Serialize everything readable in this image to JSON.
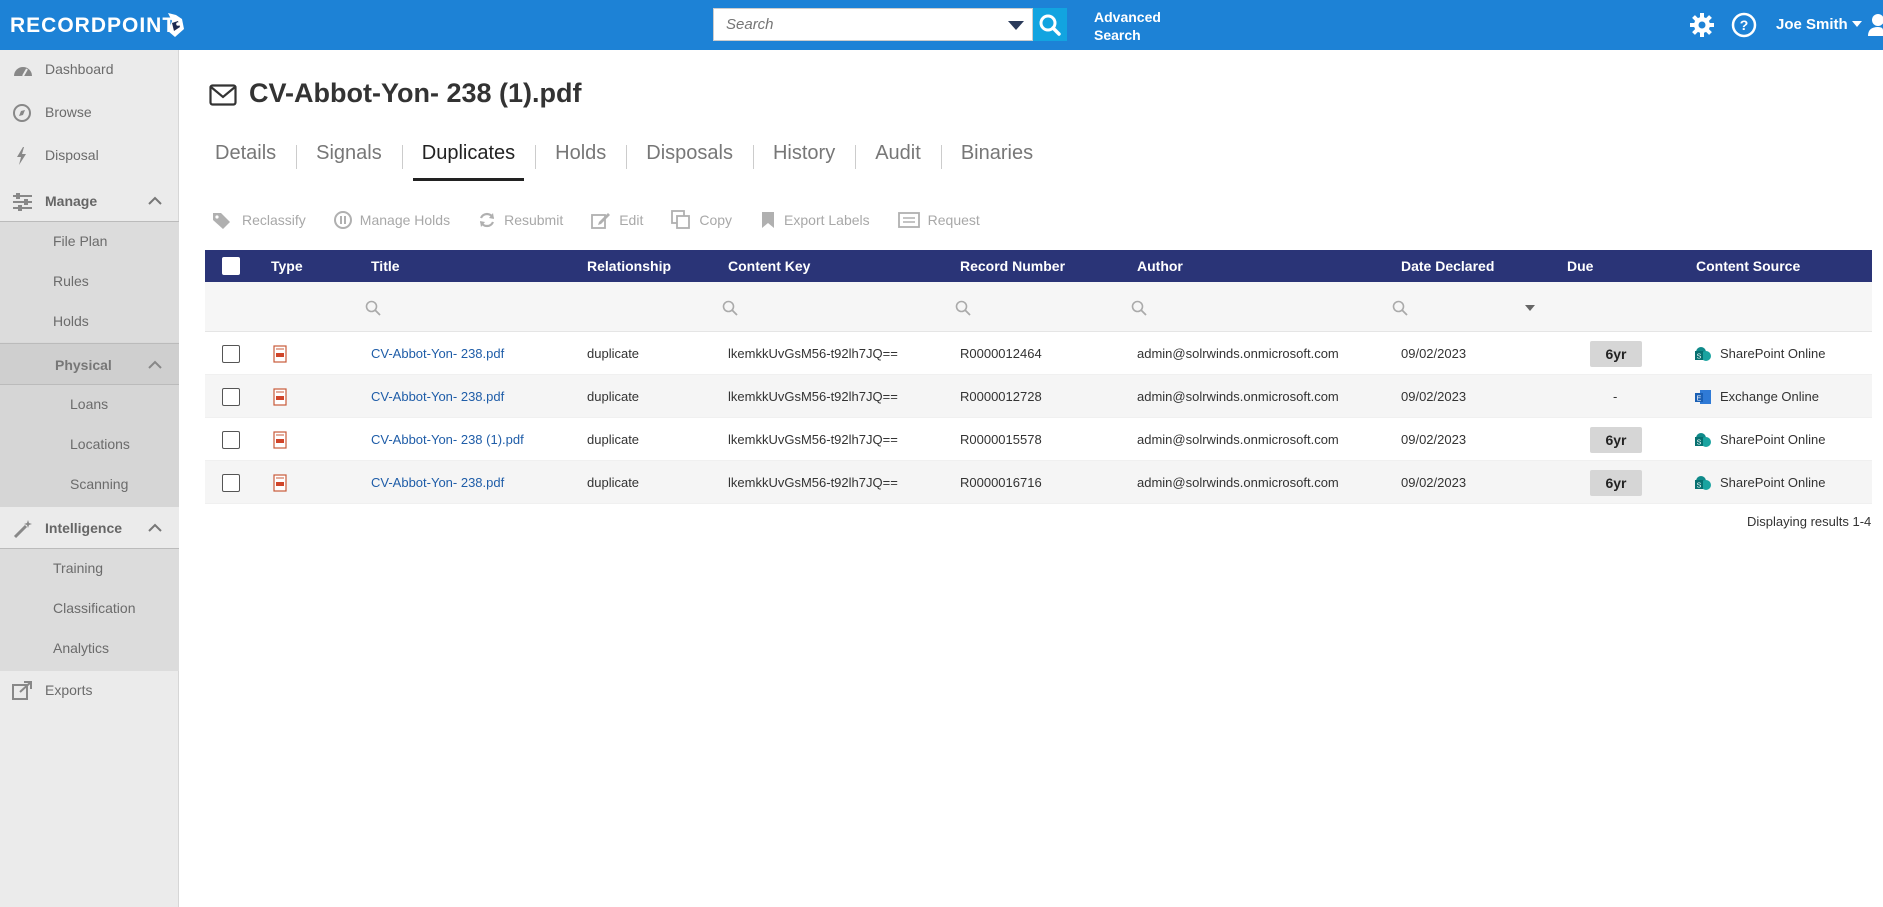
{
  "header": {
    "logo": "RECORDPOINT",
    "search_placeholder": "Search",
    "advanced_search_line1": "Advanced",
    "advanced_search_line2": "Search",
    "user_name": "Joe Smith",
    "colors": {
      "topbar": "#1d82d6",
      "search_button": "#12a4e0"
    }
  },
  "sidebar": {
    "dashboard": "Dashboard",
    "browse": "Browse",
    "disposal": "Disposal",
    "manage": "Manage",
    "manage_items": [
      "File Plan",
      "Rules",
      "Holds"
    ],
    "physical": "Physical",
    "physical_items": [
      "Loans",
      "Locations",
      "Scanning"
    ],
    "intelligence": "Intelligence",
    "intelligence_items": [
      "Training",
      "Classification",
      "Analytics"
    ],
    "exports": "Exports"
  },
  "page": {
    "title": "CV-Abbot-Yon- 238 (1).pdf",
    "tabs": [
      "Details",
      "Signals",
      "Duplicates",
      "Holds",
      "Disposals",
      "History",
      "Audit",
      "Binaries"
    ],
    "active_tab": "Duplicates"
  },
  "actions": [
    "Reclassify",
    "Manage Holds",
    "Resubmit",
    "Edit",
    "Copy",
    "Export Labels",
    "Request"
  ],
  "table": {
    "header_color": "#2a3477",
    "columns": [
      "Type",
      "Title",
      "Relationship",
      "Content Key",
      "Record Number",
      "Author",
      "Date Declared",
      "Due",
      "Content Source"
    ],
    "rows": [
      {
        "title": "CV-Abbot-Yon- 238.pdf",
        "relationship": "duplicate",
        "content_key": "lkemkkUvGsM56-t92lh7JQ==",
        "record_number": "R0000012464",
        "author": "admin@solrwinds.onmicrosoft.com",
        "date_declared": "09/02/2023",
        "due": "6yr",
        "content_source": "SharePoint Online",
        "source_icon": "sharepoint-icon"
      },
      {
        "title": "CV-Abbot-Yon- 238.pdf",
        "relationship": "duplicate",
        "content_key": "lkemkkUvGsM56-t92lh7JQ==",
        "record_number": "R0000012728",
        "author": "admin@solrwinds.onmicrosoft.com",
        "date_declared": "09/02/2023",
        "due": "-",
        "content_source": "Exchange Online",
        "source_icon": "exchange-icon"
      },
      {
        "title": "CV-Abbot-Yon- 238 (1).pdf",
        "relationship": "duplicate",
        "content_key": "lkemkkUvGsM56-t92lh7JQ==",
        "record_number": "R0000015578",
        "author": "admin@solrwinds.onmicrosoft.com",
        "date_declared": "09/02/2023",
        "due": "6yr",
        "content_source": "SharePoint Online",
        "source_icon": "sharepoint-icon"
      },
      {
        "title": "CV-Abbot-Yon- 238.pdf",
        "relationship": "duplicate",
        "content_key": "lkemkkUvGsM56-t92lh7JQ==",
        "record_number": "R0000016716",
        "author": "admin@solrwinds.onmicrosoft.com",
        "date_declared": "09/02/2023",
        "due": "6yr",
        "content_source": "SharePoint Online",
        "source_icon": "sharepoint-icon"
      }
    ],
    "footer": "Displaying results 1-4"
  }
}
